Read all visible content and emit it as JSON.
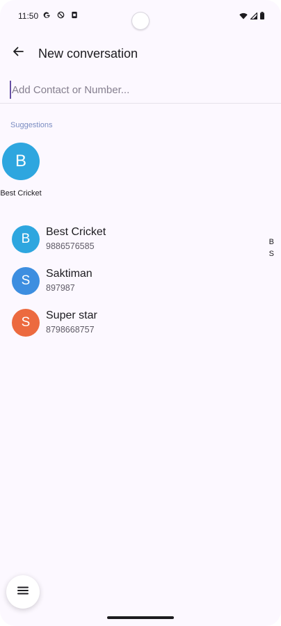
{
  "status_bar": {
    "time": "11:50",
    "left_icons": [
      "google-icon",
      "dnd-icon",
      "sim-icon"
    ],
    "right_icons": [
      "wifi-icon",
      "signal-icon",
      "battery-icon"
    ]
  },
  "app_bar": {
    "back_icon": "arrow-left-icon",
    "title": "New conversation"
  },
  "input": {
    "placeholder": "Add Contact or Number...",
    "value": ""
  },
  "suggestions": {
    "heading": "Suggestions",
    "items": [
      {
        "initial": "B",
        "name": "Best Cricket",
        "color": "#2ea6df"
      }
    ]
  },
  "contacts": [
    {
      "initial": "B",
      "name": "Best Cricket",
      "number": "9886576585",
      "color": "#2ea6df"
    },
    {
      "initial": "S",
      "name": "Saktiman",
      "number": "897987",
      "color": "#3d8ee0"
    },
    {
      "initial": "S",
      "name": "Super star",
      "number": "8798668757",
      "color": "#ec6a3f"
    }
  ],
  "index_scroller": [
    "B",
    "S"
  ],
  "menu_button": {
    "icon": "menu-icon"
  },
  "colors": {
    "background": "#fcf8ff",
    "accent": "#6750a4",
    "heading": "#7a8cc2"
  }
}
